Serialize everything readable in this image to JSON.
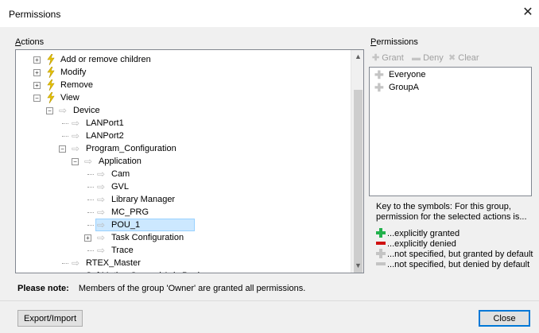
{
  "window": {
    "title": "Permissions",
    "close_glyph": "✕"
  },
  "actions": {
    "label_prefix": "A",
    "label_rest": "ctions",
    "tree": [
      {
        "label": "Add or remove children",
        "icon": "bolt-icon",
        "expander": "+"
      },
      {
        "label": "Modify",
        "icon": "bolt-icon",
        "expander": "+"
      },
      {
        "label": "Remove",
        "icon": "bolt-icon",
        "expander": "+"
      },
      {
        "label": "View",
        "icon": "bolt-icon",
        "expander": "−"
      },
      {
        "label": "Device",
        "icon": "arrow-icon",
        "expander": "−"
      },
      {
        "label": "LANPort1",
        "icon": "arrow-icon"
      },
      {
        "label": "LANPort2",
        "icon": "arrow-icon"
      },
      {
        "label": "Program_Configuration",
        "icon": "arrow-icon",
        "expander": "−"
      },
      {
        "label": "Application",
        "icon": "arrow-icon",
        "expander": "−"
      },
      {
        "label": "Cam",
        "icon": "arrow-icon"
      },
      {
        "label": "GVL",
        "icon": "arrow-icon"
      },
      {
        "label": "Library Manager",
        "icon": "arrow-icon"
      },
      {
        "label": "MC_PRG",
        "icon": "arrow-icon"
      },
      {
        "label": "POU_1",
        "icon": "arrow-icon",
        "selected": true
      },
      {
        "label": "Task Configuration",
        "icon": "arrow-icon",
        "expander": "+"
      },
      {
        "label": "Trace",
        "icon": "arrow-icon"
      },
      {
        "label": "RTEX_Master",
        "icon": "arrow-icon"
      },
      {
        "label": "SoftMotion General Axis Pool",
        "icon": "arrow-icon"
      }
    ]
  },
  "permissions": {
    "label_prefix": "P",
    "label_rest": "ermissions",
    "toolbar": {
      "grant": "Grant",
      "deny": "Deny",
      "clear": "Clear"
    },
    "groups": [
      "Everyone",
      "GroupA"
    ]
  },
  "key": {
    "intro": "Key to the symbols: For this group, permission for the selected actions is...",
    "items": [
      {
        "text": "...explicitly granted",
        "color": "#22b14c"
      },
      {
        "text": "...explicitly denied",
        "color": "#d01010"
      },
      {
        "text": "...not specified, but granted by default",
        "color": "#c4c4c4"
      },
      {
        "text": "...not specified, but denied by default",
        "color": "#c4c4c4"
      }
    ]
  },
  "note": {
    "title": "Please note:",
    "text": "Members of the group 'Owner' are granted all permissions."
  },
  "buttons": {
    "export_import": "Export/Import",
    "close": "Close"
  }
}
